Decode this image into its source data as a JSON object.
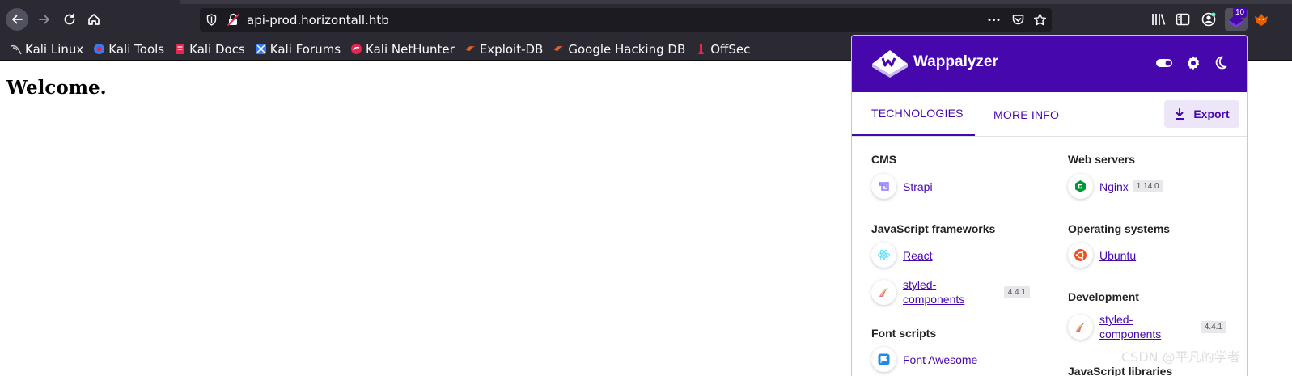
{
  "browser": {
    "url": "api-prod.horizontall.htb",
    "extension_badge": "10"
  },
  "bookmarks": [
    {
      "label": "Kali Linux",
      "icon": "kali-dragon-icon"
    },
    {
      "label": "Kali Tools",
      "icon": "kali-tools-icon"
    },
    {
      "label": "Kali Docs",
      "icon": "kali-docs-icon"
    },
    {
      "label": "Kali Forums",
      "icon": "kali-forums-icon"
    },
    {
      "label": "Kali NetHunter",
      "icon": "kali-nethunter-icon"
    },
    {
      "label": "Exploit-DB",
      "icon": "exploit-db-icon"
    },
    {
      "label": "Google Hacking DB",
      "icon": "ghdb-icon"
    },
    {
      "label": "OffSec",
      "icon": "offsec-icon"
    }
  ],
  "page": {
    "heading": "Welcome."
  },
  "wappalyzer": {
    "brand": "Wappalyzer",
    "tabs": {
      "technologies": "TECHNOLOGIES",
      "more_info": "MORE INFO"
    },
    "export_label": "Export",
    "colors": {
      "brand": "#4608ad"
    },
    "left": {
      "cms": {
        "title": "CMS",
        "items": [
          {
            "name": "Strapi",
            "icon": "strapi-icon"
          }
        ]
      },
      "js_frameworks": {
        "title": "JavaScript frameworks",
        "items": [
          {
            "name": "React",
            "icon": "react-icon"
          },
          {
            "name_line1": "styled-",
            "name_line2": "components",
            "version": "4.4.1",
            "icon": "styled-components-icon"
          }
        ]
      },
      "font_scripts": {
        "title": "Font scripts",
        "items": [
          {
            "name": "Font Awesome",
            "icon": "font-awesome-icon"
          }
        ]
      }
    },
    "right": {
      "web_servers": {
        "title": "Web servers",
        "items": [
          {
            "name": "Nginx",
            "version": "1.14.0",
            "icon": "nginx-icon"
          }
        ]
      },
      "operating_systems": {
        "title": "Operating systems",
        "items": [
          {
            "name": "Ubuntu",
            "icon": "ubuntu-icon"
          }
        ]
      },
      "development": {
        "title": "Development",
        "items": [
          {
            "name_line1": "styled-",
            "name_line2": "components",
            "version": "4.4.1",
            "icon": "styled-components-icon"
          }
        ]
      },
      "js_libraries": {
        "title": "JavaScript libraries"
      }
    }
  },
  "watermark": "CSDN @平凡的学者"
}
